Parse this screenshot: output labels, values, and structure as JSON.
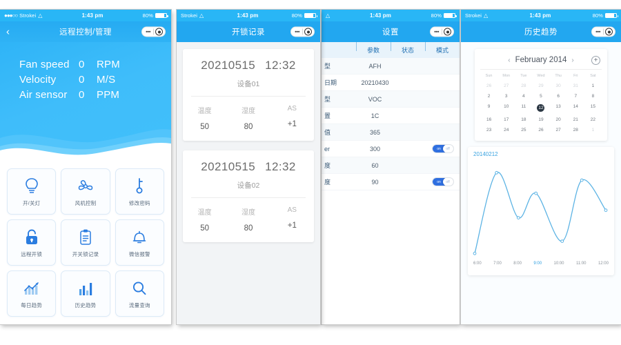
{
  "status_bar": {
    "carrier": "Strokei",
    "dots": "●●●○○",
    "wifi_icon": "wifi-icon",
    "time": "1:43 pm",
    "battery_percent": "80%"
  },
  "nav_caps": {
    "dots": "•••",
    "circle_icon": "record-circle-icon"
  },
  "screen1": {
    "title": "远程控制/管理",
    "back_icon": "chevron-left-icon",
    "stats": [
      {
        "name": "Fan speed",
        "value": "0",
        "unit": "RPM"
      },
      {
        "name": "Velocity",
        "value": "0",
        "unit": "M/S"
      },
      {
        "name": "Air sensor",
        "value": "0",
        "unit": "PPM"
      }
    ],
    "tiles": [
      {
        "label": "开/关灯",
        "icon": "lightbulb-icon"
      },
      {
        "label": "风机控制",
        "icon": "fan-icon"
      },
      {
        "label": "修改密码",
        "icon": "key-icon"
      },
      {
        "label": "远程开锁",
        "icon": "lock-icon"
      },
      {
        "label": "开关锁记录",
        "icon": "clipboard-icon"
      },
      {
        "label": "微信报警",
        "icon": "bell-icon"
      },
      {
        "label": "每日趋势",
        "icon": "trend-chart-icon"
      },
      {
        "label": "历史趋势",
        "icon": "bar-chart-icon"
      },
      {
        "label": "流量查询",
        "icon": "search-icon"
      }
    ]
  },
  "screen2": {
    "title": "开锁记录",
    "records": [
      {
        "date": "20210515",
        "time": "12:32",
        "device": "设备01",
        "metrics": [
          {
            "key": "温度",
            "value": "50"
          },
          {
            "key": "湿度",
            "value": "80"
          },
          {
            "key": "AS",
            "value": "+1"
          }
        ]
      },
      {
        "date": "20210515",
        "time": "12:32",
        "device": "设备02",
        "metrics": [
          {
            "key": "温度",
            "value": "50"
          },
          {
            "key": "湿度",
            "value": "80"
          },
          {
            "key": "AS",
            "value": "+1"
          }
        ]
      }
    ]
  },
  "screen3": {
    "title": "设置",
    "columns": [
      "",
      "参数",
      "状态",
      "模式"
    ],
    "rows": [
      {
        "name": "型",
        "param": "AFH",
        "toggle": null
      },
      {
        "name": "日期",
        "param": "20210430",
        "toggle": null
      },
      {
        "name": "型",
        "param": "VOC",
        "toggle": null
      },
      {
        "name": "置",
        "param": "1C",
        "toggle": null
      },
      {
        "name": "值",
        "param": "365",
        "toggle": null
      },
      {
        "name": "er",
        "param": "300",
        "toggle": "on"
      },
      {
        "name": "度",
        "param": "60",
        "toggle": null
      },
      {
        "name": "度",
        "param": "90",
        "toggle": "on"
      }
    ],
    "toggle_on_label": "on",
    "toggle_off_label": "off"
  },
  "screen4": {
    "title": "历史趋势",
    "calendar": {
      "month_title": "February 2014",
      "prev_icon": "chevron-left-icon",
      "next_icon": "chevron-right-icon",
      "add_icon": "plus-circle-icon",
      "day_names": [
        "Sun",
        "Mon",
        "Tue",
        "Wed",
        "Thu",
        "Fri",
        "Sat"
      ],
      "weeks": [
        [
          {
            "d": "26",
            "m": true
          },
          {
            "d": "27",
            "m": true
          },
          {
            "d": "28",
            "m": true
          },
          {
            "d": "29",
            "m": true
          },
          {
            "d": "30",
            "m": true
          },
          {
            "d": "31",
            "m": true
          },
          {
            "d": "1",
            "m": false
          }
        ],
        [
          {
            "d": "2",
            "m": false
          },
          {
            "d": "3",
            "m": false
          },
          {
            "d": "4",
            "m": false
          },
          {
            "d": "5",
            "m": false
          },
          {
            "d": "6",
            "m": false
          },
          {
            "d": "7",
            "m": false
          },
          {
            "d": "8",
            "m": false
          }
        ],
        [
          {
            "d": "9",
            "m": false
          },
          {
            "d": "10",
            "m": false
          },
          {
            "d": "11",
            "m": false
          },
          {
            "d": "12",
            "m": false,
            "sel": true
          },
          {
            "d": "13",
            "m": false
          },
          {
            "d": "14",
            "m": false
          },
          {
            "d": "15",
            "m": false
          }
        ],
        [
          {
            "d": "16",
            "m": false
          },
          {
            "d": "17",
            "m": false
          },
          {
            "d": "18",
            "m": false
          },
          {
            "d": "19",
            "m": false
          },
          {
            "d": "20",
            "m": false
          },
          {
            "d": "21",
            "m": false
          },
          {
            "d": "22",
            "m": false
          }
        ],
        [
          {
            "d": "23",
            "m": false
          },
          {
            "d": "24",
            "m": false
          },
          {
            "d": "25",
            "m": false
          },
          {
            "d": "26",
            "m": false
          },
          {
            "d": "27",
            "m": false
          },
          {
            "d": "28",
            "m": false
          },
          {
            "d": "1",
            "m": true
          }
        ]
      ]
    },
    "chart_label": "20140212",
    "x_ticks": [
      "6:00",
      "7:00",
      "8:00",
      "9:00",
      "10:00",
      "11:00",
      "12:00"
    ],
    "highlight_tick": "9:00"
  },
  "chart_data": {
    "type": "line",
    "title": "20140212",
    "xlabel": "",
    "ylabel": "",
    "x": [
      "6:00",
      "7:00",
      "8:00",
      "9:00",
      "10:00",
      "11:00",
      "12:00"
    ],
    "x_numeric": [
      6,
      7,
      8,
      8.8,
      10,
      10.9,
      12
    ],
    "values": [
      2,
      88,
      40,
      66,
      15,
      80,
      48
    ],
    "ylim": [
      0,
      100
    ],
    "grid": false,
    "legend": "none",
    "line_color": "#5cb3e4",
    "markers": true,
    "smooth": true
  },
  "colors": {
    "accent_blue": "#22a7f0",
    "hero_blue": "#3fbdfa",
    "toggle_on": "#2f6fe0",
    "chart_line": "#5cb3e4",
    "tile_border": "#dceaf7"
  }
}
